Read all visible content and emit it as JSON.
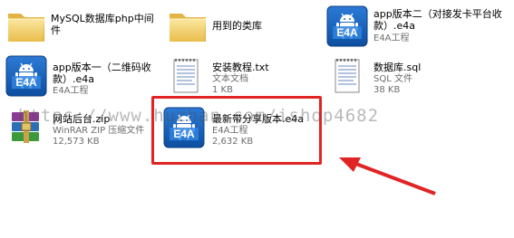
{
  "files": [
    {
      "key": "mysql",
      "type": "folder",
      "name": "MySQL数据库php中间件"
    },
    {
      "key": "libs",
      "type": "folder",
      "name": "用到的类库"
    },
    {
      "key": "app2",
      "type": "e4a",
      "name": "app版本二（对接发卡平台收款）.e4a",
      "meta1": "E4A工程"
    },
    {
      "key": "app1",
      "type": "e4a",
      "name": "app版本一（二维码收款）.e4a",
      "meta1": "E4A工程"
    },
    {
      "key": "install",
      "type": "txt",
      "name": "安装教程.txt",
      "meta1": "文本文档",
      "meta2": "1 KB"
    },
    {
      "key": "db",
      "type": "sql",
      "name": "数据库.sql",
      "meta1": "SQL 文件",
      "meta2": "38 KB"
    },
    {
      "key": "web",
      "type": "rar",
      "name": "网站后台.zip",
      "meta1": "WinRAR ZIP 压缩文件",
      "meta2": "12,573 KB"
    },
    {
      "key": "share",
      "type": "e4a",
      "name": "最新带分享版本.e4a",
      "meta1": "E4A工程",
      "meta2": "2,632 KB"
    }
  ],
  "watermark": "https://www.huzhan.com/ishop4682",
  "colors": {
    "highlight": "#e02424",
    "e4a_blue": "#1565c0",
    "android_green": "#a4c639",
    "folder_yellow": "#f5d46b"
  }
}
